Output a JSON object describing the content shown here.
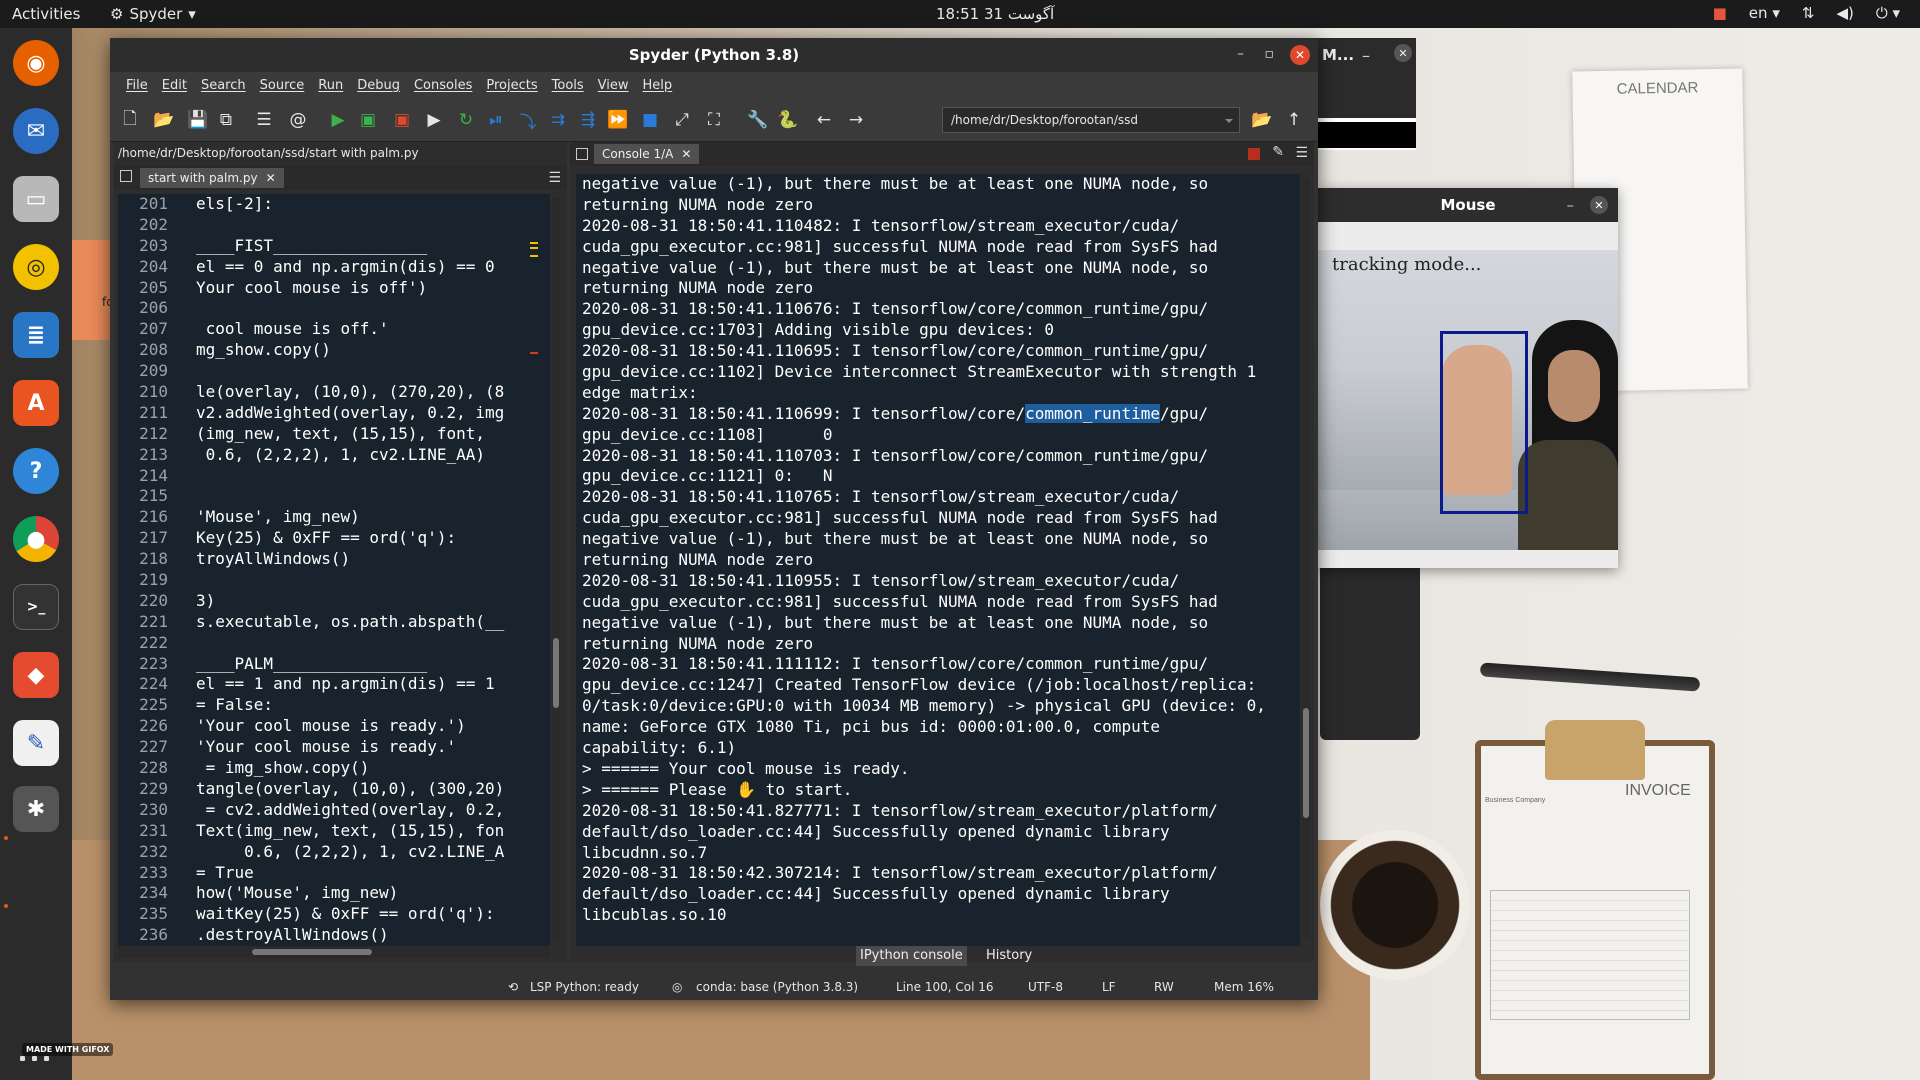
{
  "topbar": {
    "activities": "Activities",
    "app_name": "Spyder",
    "clock": "18:51  31 آگوست",
    "lang": "en"
  },
  "mouse_window_small": {
    "title": "M..."
  },
  "mouse_window": {
    "title": "Mouse",
    "overlay_text": "tracking mode..."
  },
  "desktop": {
    "calendar_title": "CALENDAR",
    "invoice_title": "INVOICE",
    "invoice_company": "Business Company",
    "note_text": "fc",
    "gifox": "MADE WITH GIFOX"
  },
  "spyder": {
    "title": "Spyder (Python 3.8)",
    "menu": [
      "File",
      "Edit",
      "Search",
      "Source",
      "Run",
      "Debug",
      "Consoles",
      "Projects",
      "Tools",
      "View",
      "Help"
    ],
    "path": "/home/dr/Desktop/forootan/ssd",
    "editor": {
      "filepath": "/home/dr/Desktop/forootan/ssd/start with palm.py",
      "tab": "start with palm.py",
      "lines": [
        {
          "n": "201",
          "t": "els[-2]:"
        },
        {
          "n": "202",
          "t": ""
        },
        {
          "n": "203",
          "t": "____FIST________________"
        },
        {
          "n": "204",
          "t": "el == 0 and np.argmin(dis) == 0"
        },
        {
          "n": "205",
          "t": "Your cool mouse is off')"
        },
        {
          "n": "206",
          "t": ""
        },
        {
          "n": "207",
          "t": " cool mouse is off.'"
        },
        {
          "n": "208",
          "t": "mg_show.copy()"
        },
        {
          "n": "209",
          "t": ""
        },
        {
          "n": "210",
          "t": "le(overlay, (10,0), (270,20), (8"
        },
        {
          "n": "211",
          "t": "v2.addWeighted(overlay, 0.2, img"
        },
        {
          "n": "212",
          "t": "(img_new, text, (15,15), font,"
        },
        {
          "n": "213",
          "t": " 0.6, (2,2,2), 1, cv2.LINE_AA)"
        },
        {
          "n": "214",
          "t": ""
        },
        {
          "n": "215",
          "t": ""
        },
        {
          "n": "216",
          "t": "'Mouse', img_new)"
        },
        {
          "n": "217",
          "t": "Key(25) & 0xFF == ord('q'):"
        },
        {
          "n": "218",
          "t": "troyAllWindows()"
        },
        {
          "n": "219",
          "t": ""
        },
        {
          "n": "220",
          "t": "3)"
        },
        {
          "n": "221",
          "t": "s.executable, os.path.abspath(__"
        },
        {
          "n": "222",
          "t": ""
        },
        {
          "n": "223",
          "t": "____PALM________________"
        },
        {
          "n": "224",
          "t": "el == 1 and np.argmin(dis) == 1"
        },
        {
          "n": "225",
          "t": "= False:"
        },
        {
          "n": "226",
          "t": "'Your cool mouse is ready.')"
        },
        {
          "n": "227",
          "t": "'Your cool mouse is ready.'"
        },
        {
          "n": "228",
          "t": " = img_show.copy()"
        },
        {
          "n": "229",
          "t": "tangle(overlay, (10,0), (300,20)"
        },
        {
          "n": "230",
          "t": " = cv2.addWeighted(overlay, 0.2,"
        },
        {
          "n": "231",
          "t": "Text(img_new, text, (15,15), fon"
        },
        {
          "n": "232",
          "t": "     0.6, (2,2,2), 1, cv2.LINE_A"
        },
        {
          "n": "233",
          "t": "= True"
        },
        {
          "n": "234",
          "t": "how('Mouse', img_new)"
        },
        {
          "n": "235",
          "t": "waitKey(25) & 0xFF == ord('q'):"
        },
        {
          "n": "236",
          "t": ".destroyAllWindows()"
        }
      ]
    },
    "console": {
      "tab": "Console 1/A",
      "lines": [
        "negative value (-1), but there must be at least one NUMA node, so",
        "returning NUMA node zero",
        "2020-08-31 18:50:41.110482: I tensorflow/stream_executor/cuda/",
        "cuda_gpu_executor.cc:981] successful NUMA node read from SysFS had",
        "negative value (-1), but there must be at least one NUMA node, so",
        "returning NUMA node zero",
        "2020-08-31 18:50:41.110676: I tensorflow/core/common_runtime/gpu/",
        "gpu_device.cc:1703] Adding visible gpu devices: 0",
        "2020-08-31 18:50:41.110695: I tensorflow/core/common_runtime/gpu/",
        "gpu_device.cc:1102] Device interconnect StreamExecutor with strength 1",
        "edge matrix:",
        "2020-08-31 18:50:41.110699: I tensorflow/core/",
        "gpu_device.cc:1108]      0",
        "2020-08-31 18:50:41.110703: I tensorflow/core/common_runtime/gpu/",
        "gpu_device.cc:1121] 0:   N",
        "2020-08-31 18:50:41.110765: I tensorflow/stream_executor/cuda/",
        "cuda_gpu_executor.cc:981] successful NUMA node read from SysFS had",
        "negative value (-1), but there must be at least one NUMA node, so",
        "returning NUMA node zero",
        "2020-08-31 18:50:41.110955: I tensorflow/stream_executor/cuda/",
        "cuda_gpu_executor.cc:981] successful NUMA node read from SysFS had",
        "negative value (-1), but there must be at least one NUMA node, so",
        "returning NUMA node zero",
        "2020-08-31 18:50:41.111112: I tensorflow/core/common_runtime/gpu/",
        "gpu_device.cc:1247] Created TensorFlow device (/job:localhost/replica:",
        "0/task:0/device:GPU:0 with 10034 MB memory) -> physical GPU (device: 0,",
        "name: GeForce GTX 1080 Ti, pci bus id: 0000:01:00.0, compute",
        "capability: 6.1)",
        "> ====== Your cool mouse is ready.",
        "> ====== Please ✋ to start.",
        "2020-08-31 18:50:41.827771: I tensorflow/stream_executor/platform/",
        "default/dso_loader.cc:44] Successfully opened dynamic library",
        "libcudnn.so.7",
        "2020-08-31 18:50:42.307214: I tensorflow/stream_executor/platform/",
        "default/dso_loader.cc:44] Successfully opened dynamic library",
        "libcublas.so.10"
      ],
      "highlight_text": "common_runtime",
      "highlight_suffix": "/gpu/",
      "bottom_tabs": [
        "IPython console",
        "History"
      ]
    },
    "status": {
      "lsp": "LSP Python: ready",
      "conda": "conda: base (Python 3.8.3)",
      "position": "Line 100, Col 16",
      "encoding": "UTF-8",
      "eol": "LF",
      "rw": "RW",
      "mem": "Mem 16%"
    }
  }
}
